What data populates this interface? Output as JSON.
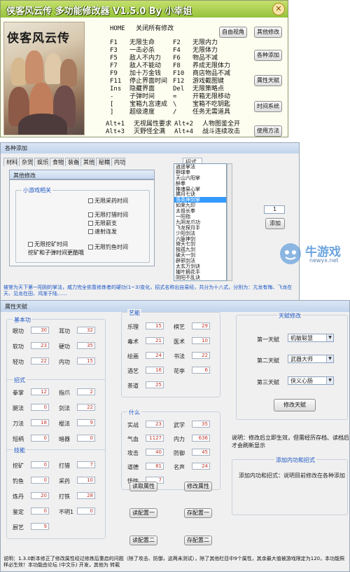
{
  "main": {
    "title": "侠客风云传 多功能修改器 V1.5.0 By 小幸姐",
    "close": "✕",
    "cover_title": "侠客风云传",
    "home_key": "HOME",
    "home_text": "关闭所有修改",
    "hotkeys_left": [
      {
        "k": "F1",
        "t": "无限生命"
      },
      {
        "k": "F3",
        "t": "一击必杀"
      },
      {
        "k": "F5",
        "t": "敌人不内力"
      },
      {
        "k": "F7",
        "t": "敌人不能动"
      },
      {
        "k": "F9",
        "t": "加十万金钱"
      },
      {
        "k": "F11",
        "t": "停止界面时间"
      },
      {
        "k": "Ins",
        "t": "隐藏界面"
      },
      {
        "k": "-",
        "t": "子弹时间"
      },
      {
        "k": "[",
        "t": "宝箱九宫速成"
      },
      {
        "k": "]",
        "t": "超级速度"
      }
    ],
    "hotkeys_right": [
      {
        "k": "F2",
        "t": "无限内力"
      },
      {
        "k": "F4",
        "t": "无限体力"
      },
      {
        "k": "F6",
        "t": "物品不减"
      },
      {
        "k": "F8",
        "t": "养成无限体力"
      },
      {
        "k": "F10",
        "t": "商店物品不减"
      },
      {
        "k": "F12",
        "t": "游戏截图键"
      },
      {
        "k": "Del",
        "t": "无限策略点"
      },
      {
        "k": "=",
        "t": "开箱无限移动"
      },
      {
        "k": "\\",
        "t": "宝箱不吃钥匙"
      },
      {
        "k": "/",
        "t": "任务无需道具"
      }
    ],
    "alt_left": [
      {
        "k": "Alt+1",
        "t": "无视属性要求"
      },
      {
        "k": "Alt+3",
        "t": "灭野怪全满"
      }
    ],
    "alt_right": [
      {
        "k": "Alt+2",
        "t": "人物图鉴全开"
      },
      {
        "k": "Alt+4",
        "t": "战斗连续攻击"
      }
    ],
    "buttons": {
      "free_view": "自由视角",
      "other_mod": "其他修改",
      "add_items": "各种添加",
      "attr_talent": "属性天赋",
      "time_system": "时间系统",
      "usage": "使用方法"
    }
  },
  "add_window": {
    "title": "各种添加",
    "tabs": [
      "材料",
      "杂货",
      "娱乐",
      "食物",
      "装备",
      "其他",
      "秘籍",
      "内功",
      "招式"
    ],
    "inner_title": "其他修改",
    "group_title": "小游戏相关",
    "checks": [
      "无限采药时间",
      "无限打猎时间",
      "无限箭支",
      "速射连发",
      "无限挖矿时间",
      "无限钓鱼时间"
    ],
    "mine_label": "挖矿和子弹时间更酷哦",
    "list": [
      "逍遥掌法",
      "野球拳",
      "天山六阳掌",
      "醉拳",
      "推魂易心掌",
      "拂月七诀",
      "落英神剑掌",
      "如来九印",
      "太祖长拳",
      "一阳指",
      "九阴龙爪功",
      "飞龙探月手",
      "少阳剑法",
      "六脉神剑",
      "倚天七剑",
      "独孤九剑",
      "破天一剑",
      "辟邪剑法",
      "太玄万剑诀",
      "摧叶摘花手",
      "阴阳不乱诀"
    ],
    "selected_index": 6,
    "qty": "1",
    "add_button": "添加",
    "desc": "被誉为天下第一阳刚的掌法，威力完全依靠修炼者的硬功(1~3)变化，招式名称出自易经，共分为十八式，分别为：亢龙有悔、飞龙在天、见龙在田、鸿渐于陆……"
  },
  "attr_window": {
    "title": "属性天赋",
    "basic": {
      "title": "基本功",
      "items": [
        {
          "l": "眼功",
          "v": "30"
        },
        {
          "l": "耳功",
          "v": "32"
        },
        {
          "l": "软功",
          "v": "23"
        },
        {
          "l": "硬功",
          "v": "35"
        },
        {
          "l": "轻功",
          "v": "22"
        },
        {
          "l": "内功",
          "v": "15"
        }
      ]
    },
    "moves": {
      "title": "招式",
      "items": [
        {
          "l": "拳掌",
          "v": "12"
        },
        {
          "l": "指爪",
          "v": "2"
        },
        {
          "l": "腿法",
          "v": "0"
        },
        {
          "l": "剑法",
          "v": "22"
        },
        {
          "l": "刀法",
          "v": "18"
        },
        {
          "l": "棍法",
          "v": "9"
        },
        {
          "l": "短柄",
          "v": "0"
        },
        {
          "l": "暗器",
          "v": "0"
        },
        {
          "l": "琴功",
          "v": "0"
        }
      ]
    },
    "skills": {
      "title": "技能",
      "items": [
        {
          "l": "挖矿",
          "v": "0"
        },
        {
          "l": "打猎",
          "v": "7"
        },
        {
          "l": "钓鱼",
          "v": "0"
        },
        {
          "l": "采药",
          "v": "10"
        },
        {
          "l": "炼丹",
          "v": "20"
        },
        {
          "l": "打铁",
          "v": "28"
        },
        {
          "l": "鉴定",
          "v": "0"
        },
        {
          "l": "不明1",
          "v": "0"
        },
        {
          "l": "厨艺",
          "v": "9"
        }
      ]
    },
    "arts": {
      "title": "艺能",
      "items": [
        {
          "l": "乐理",
          "v": "15"
        },
        {
          "l": "棋艺",
          "v": "29"
        },
        {
          "l": "毒术",
          "v": "21"
        },
        {
          "l": "医术",
          "v": "10"
        },
        {
          "l": "绘画",
          "v": "24"
        },
        {
          "l": "书法",
          "v": "22"
        },
        {
          "l": "酒艺",
          "v": "16"
        },
        {
          "l": "花亭",
          "v": "6"
        },
        {
          "l": "茶道",
          "v": "25"
        }
      ]
    },
    "misc": {
      "title": "什么",
      "items": [
        {
          "l": "实战",
          "v": "23"
        },
        {
          "l": "武学",
          "v": "35"
        },
        {
          "l": "气血",
          "v": "1127"
        },
        {
          "l": "内力",
          "v": "636"
        },
        {
          "l": "攻击",
          "v": "40"
        },
        {
          "l": "防御",
          "v": "45"
        },
        {
          "l": "道德",
          "v": "81"
        },
        {
          "l": "名声",
          "v": "24"
        },
        {
          "l": "悟性",
          "v": "7"
        }
      ]
    },
    "buttons": {
      "read": "读取属性",
      "write": "修改属性",
      "read2": "读配置一",
      "save2": "存配置一",
      "read3": "读配置二",
      "save3": "存配置二"
    },
    "talent": {
      "title": "天赋修改",
      "rows": [
        {
          "l": "第一天赋",
          "v": "机敏聪慧"
        },
        {
          "l": "第二天赋",
          "v": "武器大师"
        },
        {
          "l": "第三天赋",
          "v": "侠义心肠"
        }
      ],
      "button": "修改天赋"
    },
    "note": "说明：修改后立即生效，但需经历存档、读档后才会刷新显示",
    "add_section": {
      "title": "添加内功和招式",
      "text": "添加内功和招式：说明目前修改在各种添加窗口里"
    },
    "footer": "说明：1.3.0新本修正了修改属性经过修炼后重启的问题（除了攻击、防御，这两未测试），除了其他栏目中9个属性，其余最大值被游戏限定为120，本功能照样必生效！本功能由论坛 (中文乐) 开发，其他为 转载"
  },
  "watermark": {
    "brand": "牛游戏",
    "url": "newyx.net"
  }
}
